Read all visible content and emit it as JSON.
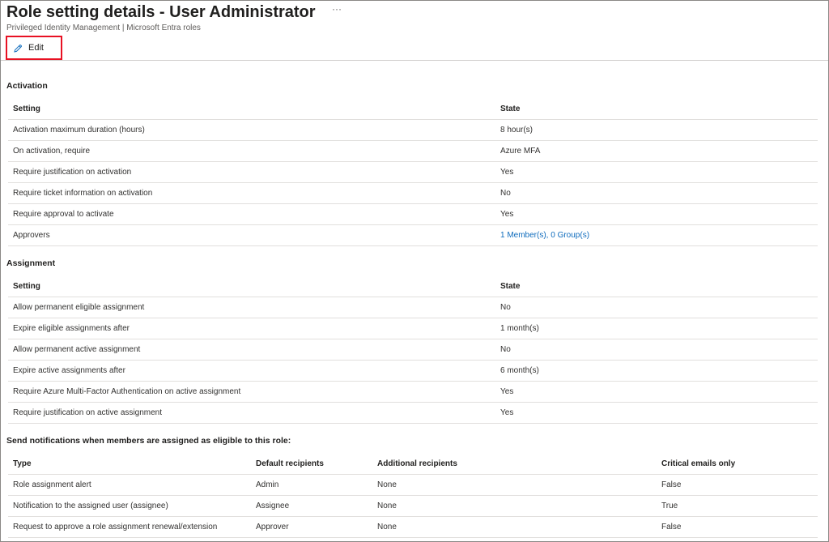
{
  "header": {
    "title": "Role setting details - User Administrator",
    "more_label": "···",
    "subtitle": "Privileged Identity Management | Microsoft Entra roles"
  },
  "toolbar": {
    "edit_label": "Edit",
    "edit_icon": "pencil-icon",
    "highlight_color": "#e81123"
  },
  "activation": {
    "title": "Activation",
    "headers": [
      "Setting",
      "State"
    ],
    "rows": [
      [
        "Activation maximum duration (hours)",
        "8 hour(s)"
      ],
      [
        "On activation, require",
        "Azure MFA"
      ],
      [
        "Require justification on activation",
        "Yes"
      ],
      [
        "Require ticket information on activation",
        "No"
      ],
      [
        "Require approval to activate",
        "Yes"
      ],
      [
        "Approvers",
        "1 Member(s), 0 Group(s)"
      ]
    ]
  },
  "assignment": {
    "title": "Assignment",
    "headers": [
      "Setting",
      "State"
    ],
    "rows": [
      [
        "Allow permanent eligible assignment",
        "No"
      ],
      [
        "Expire eligible assignments after",
        "1 month(s)"
      ],
      [
        "Allow permanent active assignment",
        "No"
      ],
      [
        "Expire active assignments after",
        "6 month(s)"
      ],
      [
        "Require Azure Multi-Factor Authentication on active assignment",
        "Yes"
      ],
      [
        "Require justification on active assignment",
        "Yes"
      ]
    ]
  },
  "notifications": {
    "title": "Send notifications when members are assigned as eligible to this role:",
    "headers": [
      "Type",
      "Default recipients",
      "Additional recipients",
      "Critical emails only"
    ],
    "rows": [
      [
        "Role assignment alert",
        "Admin",
        "None",
        "False"
      ],
      [
        "Notification to the assigned user (assignee)",
        "Assignee",
        "None",
        "True"
      ],
      [
        "Request to approve a role assignment renewal/extension",
        "Approver",
        "None",
        "False"
      ]
    ]
  },
  "colors": {
    "link": "#0f6cbd",
    "border": "#e1dfdd"
  }
}
